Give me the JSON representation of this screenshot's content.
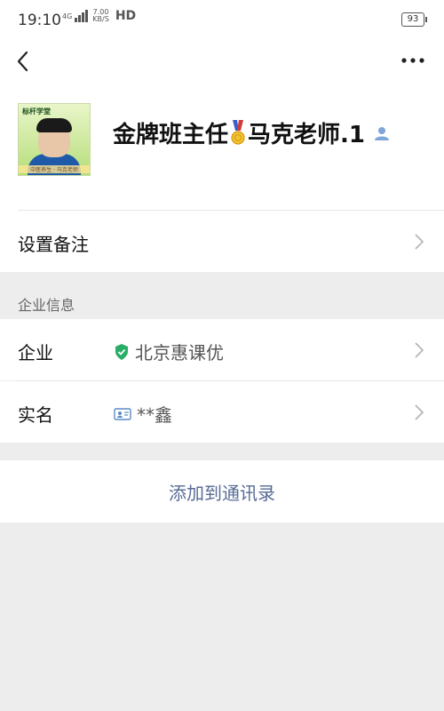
{
  "status_bar": {
    "time": "19:10",
    "network": "4G",
    "speed_value": "7.00",
    "speed_unit": "KB/S",
    "hd": "HD",
    "battery": "93"
  },
  "nav": {
    "back_icon": "chevron-left",
    "more_icon": "ellipsis"
  },
  "profile": {
    "name_part1": "金牌班主任",
    "name_part2": "马克老师.1",
    "medal_icon": "medal",
    "badge_icon": "user",
    "avatar_logo_text": "标杆学堂",
    "avatar_caption": "中医养生 · 马克老师"
  },
  "rows": {
    "remark_label": "设置备注"
  },
  "enterprise": {
    "section_title": "企业信息",
    "company_label": "企业",
    "company_value": "北京惠课优",
    "verified_color": "#2aae67",
    "realname_label": "实名",
    "realname_value": "**鑫"
  },
  "action": {
    "add_contact_label": "添加到通讯录",
    "link_color": "#576b95"
  }
}
